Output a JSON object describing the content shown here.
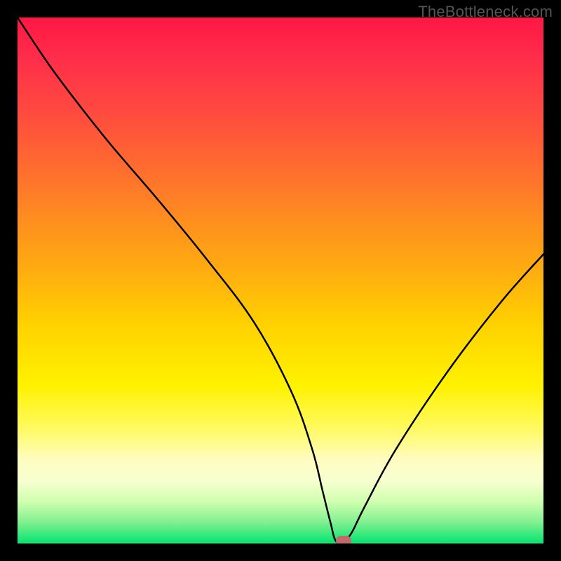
{
  "watermark": "TheBottleneck.com",
  "chart_data": {
    "type": "line",
    "x": [
      0,
      6,
      12,
      18,
      27,
      36,
      45,
      52,
      56,
      58,
      59.5,
      60.5,
      62,
      63.5,
      66,
      72,
      82,
      92,
      100
    ],
    "values": [
      100,
      91,
      83,
      75.5,
      65,
      54,
      42,
      29,
      18,
      10,
      4,
      0.5,
      0.5,
      2,
      7,
      18,
      33,
      46,
      55
    ],
    "title": "",
    "xlabel": "",
    "ylabel": "",
    "xlim": [
      0,
      100
    ],
    "ylim": [
      0,
      100
    ],
    "marker": {
      "x": 62,
      "y": 0.5,
      "color": "#c26a6a"
    }
  }
}
